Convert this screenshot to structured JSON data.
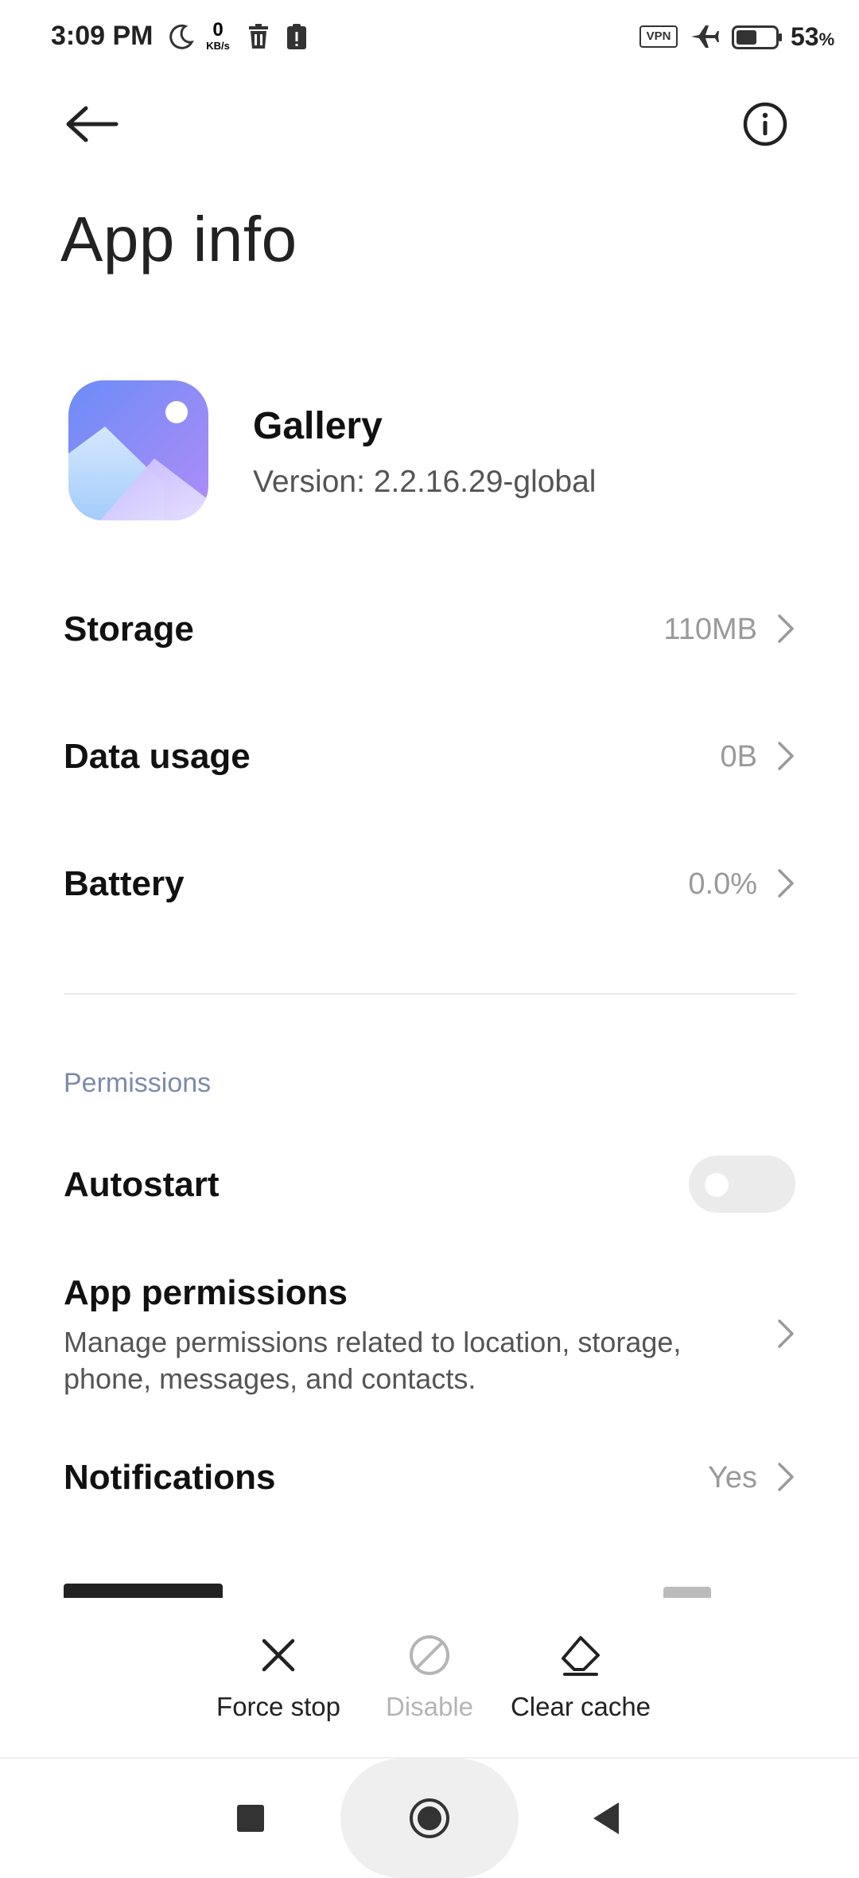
{
  "status_bar": {
    "time": "3:09 PM",
    "net_speed_value": "0",
    "net_speed_unit": "KB/s",
    "vpn_label": "VPN",
    "battery_percent": "53",
    "battery_percent_sign": "%",
    "battery_level": 0.53,
    "icons": [
      "moon-icon",
      "trash-icon",
      "clipboard-alert-icon",
      "airplane-icon",
      "battery-icon"
    ]
  },
  "header": {
    "title": "App info"
  },
  "app": {
    "name": "Gallery",
    "version": "Version: 2.2.16.29-global",
    "icon": "gallery-app-icon"
  },
  "rows": {
    "storage": {
      "label": "Storage",
      "value": "110MB"
    },
    "data_usage": {
      "label": "Data usage",
      "value": "0B"
    },
    "battery": {
      "label": "Battery",
      "value": "0.0%"
    }
  },
  "permissions": {
    "section_title": "Permissions",
    "autostart": {
      "label": "Autostart",
      "enabled": false
    },
    "app_permissions": {
      "label": "App permissions",
      "description": "Manage permissions related to location, storage, phone, messages, and contacts."
    },
    "notifications": {
      "label": "Notifications",
      "value": "Yes"
    }
  },
  "actions": {
    "force_stop": "Force stop",
    "disable": "Disable",
    "clear_cache": "Clear cache"
  },
  "colors": {
    "section_title": "#7d8ba8",
    "secondary_text": "#9a9a9a",
    "toggle_off": "#ebebeb"
  }
}
